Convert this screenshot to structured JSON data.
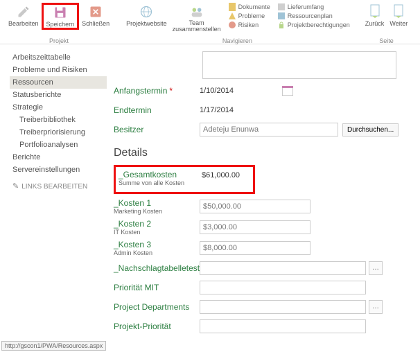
{
  "ribbon": {
    "group_project": "Projekt",
    "group_nav": "Navigieren",
    "group_page": "Seite",
    "btn_edit": "Bearbeiten",
    "btn_save": "Speichern",
    "btn_close": "Schließen",
    "btn_site": "Projektwebsite",
    "btn_team": "Team\nzusammenstellen",
    "btn_back": "Zurück",
    "btn_next": "Weiter",
    "nav_documents": "Dokumente",
    "nav_problems": "Probleme",
    "nav_risks": "Risiken",
    "nav_deliver": "Lieferumfang",
    "nav_resplan": "Ressourcenplan",
    "nav_projperm": "Projektberechtigungen"
  },
  "sidebar": {
    "timesheet": "Arbeitszeittabelle",
    "issues": "Probleme und Risiken",
    "resources": "Ressourcen",
    "statusreports": "Statusberichte",
    "strategy": "Strategie",
    "driverlib": "Treiberbibliothek",
    "driverprio": "Treiberpriorisierung",
    "portfolio": "Portfolioanalysen",
    "reports": "Berichte",
    "serversettings": "Servereinstellungen",
    "editlinks": "LINKS BEARBEITEN"
  },
  "form": {
    "start_label": "Anfangstermin",
    "start_val": "1/10/2014",
    "end_label": "Endtermin",
    "end_val": "1/17/2014",
    "owner_label": "Besitzer",
    "owner_val": "Adeteju Enunwa",
    "browse": "Durchsuchen...",
    "details_h": "Details",
    "total_label": "_Gesamtkosten",
    "total_sub": "Summe von alle Kosten",
    "total_val": "$61,000.00",
    "k1_label": "_Kosten 1",
    "k1_sub": "Marketing Kosten",
    "k1_val": "$50,000.00",
    "k2_label": "_Kosten 2",
    "k2_sub": "IT Kosten",
    "k2_val": "$3,000.00",
    "k3_label": "_Kosten 3",
    "k3_sub": "Admin Kosten",
    "k3_val": "$8,000.00",
    "lookup_label": "_Nachschlagtabelletest",
    "prio_mit": "Priorität MIT",
    "proj_dept": "Project Departments",
    "proj_prio": "Projekt-Priorität"
  },
  "status": "http://gscon1/PWA/Resources.aspx"
}
